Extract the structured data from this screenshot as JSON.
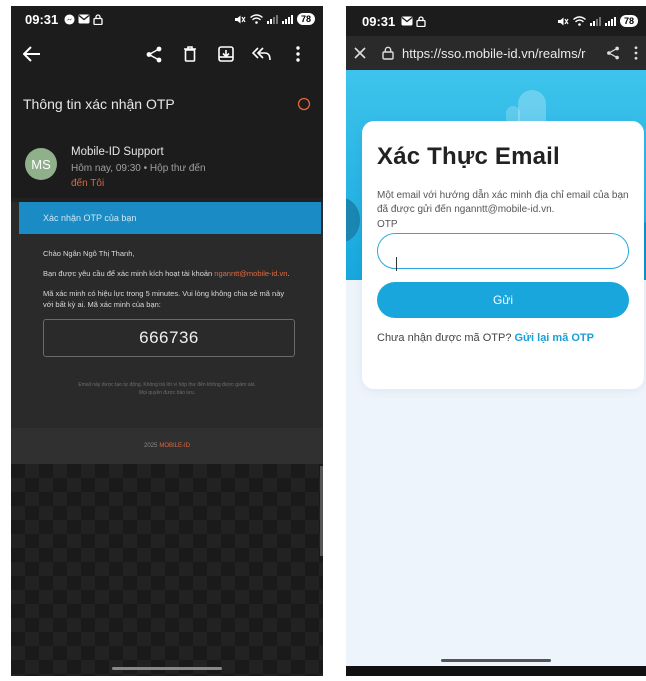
{
  "left": {
    "status": {
      "time": "09:31",
      "battery": "78"
    },
    "subject": "Thông tin xác nhận OTP",
    "sender": {
      "initials": "MS",
      "name": "Mobile-ID Support",
      "meta": "Hôm nay, 09:30  •  Hộp thư đến",
      "to": "đến Tôi"
    },
    "email": {
      "banner": "Xác nhận OTP của bạn",
      "greeting": "Chào Ngân Ngô Thị Thanh,",
      "line1_prefix": "Bạn được yêu cầu để xác minh kích hoạt tài khoản ",
      "line1_link": "nganntt@mobile-id.vn",
      "line1_suffix": ".",
      "line2": "Mã xác minh có hiệu lực trong 5 minutes. Vui lòng không chia sẻ mã này với bất kỳ ai. Mã xác minh của bạn:",
      "code": "666736",
      "foot1": "Email này được tạo tự động. Không trả lời vì hộp thư đến không được giám sát.",
      "foot2": "Mọi quyền được bảo lưu.",
      "copy_year": "2025",
      "copy_brand": "MOBILE-ID"
    }
  },
  "right": {
    "status": {
      "time": "09:31",
      "battery": "78"
    },
    "url": "https://sso.mobile-id.vn/realms/r",
    "title": "Xác Thực Email",
    "desc": "Một email với hướng dẫn xác minh địa chỉ email của bạn đã được gửi đến nganntt@mobile-id.vn.",
    "otp_label": "OTP",
    "otp_value": "",
    "send_label": "Gửi",
    "resend_prefix": "Chưa nhận được mã OTP? ",
    "resend_link": "Gửi lại mã OTP"
  },
  "colors": {
    "accent": "#18a6dc",
    "link_orange": "#e0673b",
    "dark_bg": "#212121"
  }
}
